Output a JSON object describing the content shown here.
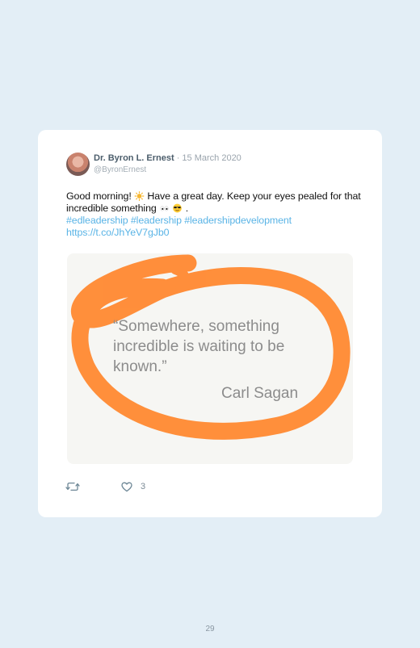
{
  "tweet": {
    "author_name": "Dr. Byron L. Ernest",
    "date": "· 15 March 2020",
    "handle": "@ByronErnest",
    "text_part1": "Good morning!",
    "text_part2": "Have a great day. Keep your eyes pealed for that incredible something",
    "text_part3": ".",
    "hashtags": "#edleadership #leadership #leadershipdevelopment",
    "link": "https://t.co/JhYeV7gJb0",
    "emoji_icons": [
      "sun-emoji",
      "eyes-emoji",
      "sunglasses-emoji"
    ],
    "like_count": "3"
  },
  "media": {
    "quote": "“Somewhere, something incredible is waiting to be known.”",
    "quote_author": "Carl Sagan",
    "accent_color": "#ff8a33"
  },
  "page": {
    "number": "29"
  }
}
